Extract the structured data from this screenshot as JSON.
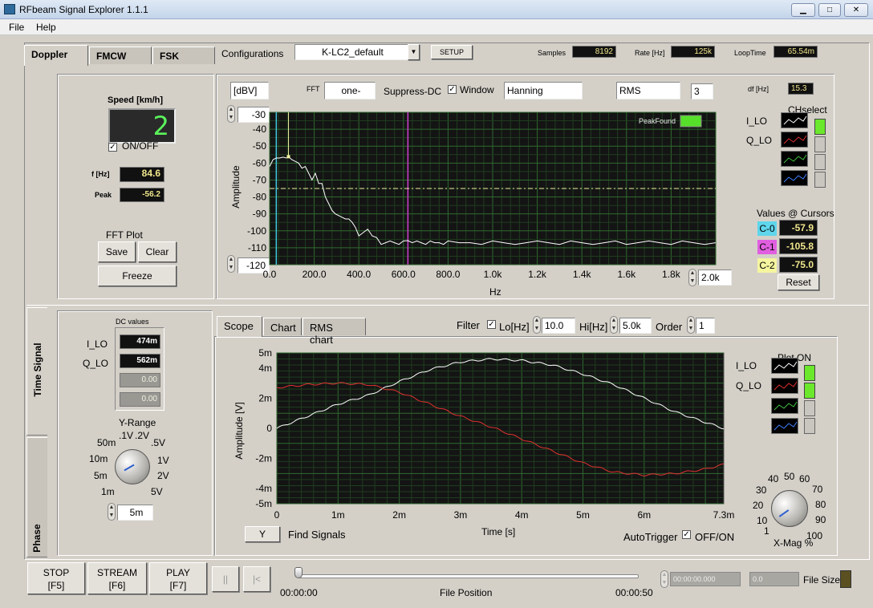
{
  "window": {
    "title": "RFbeam Signal Explorer 1.1.1"
  },
  "menu": [
    "File",
    "Help"
  ],
  "tabs_top": [
    "Doppler",
    "FMCW",
    "FSK"
  ],
  "config": {
    "label": "Configurations",
    "value": "K-LC2_default",
    "setup_label": "SETUP"
  },
  "status": {
    "samples_label": "Samples",
    "samples": "8192",
    "rate_label": "Rate [Hz]",
    "rate": "125k",
    "loop_label": "LoopTime",
    "loop": "65.54m"
  },
  "speed": {
    "label": "Speed [km/h]",
    "value": "2",
    "onoff": "ON/OFF"
  },
  "freq": {
    "f_label": "f [Hz]",
    "f_value": "84.6",
    "peak_label": "Peak",
    "peak_value": "-56.2"
  },
  "fft_plot": {
    "label": "FFT Plot",
    "save": "Save",
    "clear": "Clear",
    "freeze": "Freeze"
  },
  "fft_controls": {
    "unit": "[dBV]",
    "fft_label": "FFT",
    "fft_mode": "one-",
    "suppress_dc": "Suppress-DC",
    "window_label": "Window",
    "window_value": "Hanning",
    "rms": "RMS",
    "rms_count": "3",
    "df_label": "df [Hz]",
    "df_value": "15.3"
  },
  "fft_chart": {
    "ymax_field": "-30",
    "ymin_field": "-120",
    "xmax_field": "2.0k",
    "peakfound": "PeakFound",
    "ylabel": "Amplitude",
    "xlabel": "Hz",
    "yticks": [
      "-30",
      "-40",
      "-50",
      "-60",
      "-70",
      "-80",
      "-90",
      "-100",
      "-110",
      "-120"
    ],
    "xticks": [
      "0.0",
      "200.0",
      "400.0",
      "600.0",
      "800.0",
      "1.0k",
      "1.2k",
      "1.4k",
      "1.6k",
      "1.8k"
    ]
  },
  "chselect": {
    "label": "CHselect",
    "i_lo": "I_LO",
    "q_lo": "Q_LO"
  },
  "cursors": {
    "label": "Values @ Cursors",
    "c0": "C-0",
    "c0v": "-57.9",
    "c1": "C-1",
    "c1v": "-105.8",
    "c2": "C-2",
    "c2v": "-75.0",
    "reset": "Reset"
  },
  "side_tabs": [
    "Time Signal",
    "Phase"
  ],
  "dc": {
    "label": "DC values",
    "i_lo": "I_LO",
    "i_val": "474m",
    "q_lo": "Q_LO",
    "q_val": "562m",
    "v3": "0.00",
    "v4": "0.00"
  },
  "yrange": {
    "label": "Y-Range",
    "labels": [
      "1m",
      "5m",
      "10m",
      "50m",
      ".1V",
      ".2V",
      ".5V",
      "1V",
      "2V",
      "5V"
    ],
    "field": "5m"
  },
  "scope_tabs": [
    "Scope",
    "Chart",
    "RMS chart"
  ],
  "filter": {
    "label": "Filter",
    "lo_label": "Lo[Hz]",
    "lo_value": "10.0",
    "hi_label": "Hi[Hz]",
    "hi_value": "5.0k",
    "order_label": "Order",
    "order_value": "1"
  },
  "scope_chart": {
    "ylabel": "Amplitude [V]",
    "xlabel": "Time [s]",
    "yticks": [
      "5m",
      "4m",
      "2m",
      "0",
      "-2m",
      "-4m",
      "-5m"
    ],
    "xticks": [
      "0",
      "1m",
      "2m",
      "3m",
      "4m",
      "5m",
      "6m",
      "7.3m"
    ]
  },
  "plot_on": {
    "label": "Plot ON",
    "i_lo": "I_LO",
    "q_lo": "Q_LO"
  },
  "scope_buttons": {
    "y": "Y",
    "find": "Find Signals",
    "autotrigger": "AutoTrigger",
    "onoff": "OFF/ON"
  },
  "xmag": {
    "label": "X-Mag %",
    "labels": [
      "1",
      "10",
      "20",
      "30",
      "40",
      "50",
      "60",
      "70",
      "80",
      "90",
      "100"
    ]
  },
  "bottom": {
    "stop": "STOP",
    "stop_key": "[F5]",
    "stream": "STREAM",
    "stream_key": "[F6]",
    "play": "PLAY",
    "play_key": "[F7]",
    "pause": "||",
    "rewind": "|<",
    "t_start": "00:00:00",
    "file_pos": "File Position",
    "t_end": "00:00:50",
    "time_field": "00:00:00.000",
    "num_field": "0.0",
    "file_size": "File Size"
  },
  "chart_data": [
    {
      "type": "line",
      "title": "",
      "xlabel": "Hz",
      "ylabel": "Amplitude",
      "xlim": [
        0,
        2000
      ],
      "ylim": [
        -120,
        -30
      ],
      "series": [
        {
          "name": "",
          "color": "#ffffff",
          "x": [
            0,
            15,
            30,
            45,
            60,
            75,
            84.6,
            100,
            115,
            130,
            145,
            160,
            175,
            190,
            205,
            220,
            235,
            250,
            265,
            280,
            295,
            310,
            325,
            340,
            355,
            370,
            385,
            400,
            420,
            440,
            460,
            480,
            500,
            520,
            540,
            560,
            580,
            600,
            620,
            640,
            660,
            680,
            700,
            720,
            740,
            760,
            780,
            800,
            850,
            900,
            950,
            1000,
            1050,
            1100,
            1150,
            1200,
            1250,
            1300,
            1350,
            1400,
            1450,
            1500,
            1550,
            1600,
            1650,
            1700,
            1750,
            1800,
            1850,
            1900,
            1950,
            2000
          ],
          "y": [
            -62,
            -58,
            -57,
            -57,
            -56.5,
            -57,
            -56.2,
            -58,
            -59,
            -60,
            -63,
            -62,
            -66,
            -70,
            -66,
            -72,
            -72,
            -80,
            -84,
            -88,
            -90,
            -91,
            -92,
            -93,
            -93,
            -95,
            -98,
            -103,
            -101,
            -99,
            -103,
            -104,
            -108,
            -107,
            -106,
            -107,
            -108,
            -106,
            -105.8,
            -107,
            -106,
            -107,
            -108,
            -106,
            -107,
            -107,
            -108,
            -106,
            -107,
            -107,
            -108,
            -106,
            -107,
            -108,
            -107,
            -106,
            -107,
            -108,
            -106,
            -107,
            -108,
            -107,
            -106,
            -108,
            -107,
            -106,
            -107,
            -108,
            -106,
            -107,
            -108,
            -107
          ]
        }
      ],
      "cursors": [
        {
          "name": "C-0",
          "x": 30,
          "color": "#3ec8e0"
        },
        {
          "name": "C-1",
          "x": 620,
          "color": "#d040d0"
        },
        {
          "name": "C-2",
          "y": -75,
          "color": "#f0f0a0"
        }
      ]
    },
    {
      "type": "line",
      "title": "",
      "xlabel": "Time [s]",
      "ylabel": "Amplitude [V]",
      "xlim": [
        0,
        0.0073
      ],
      "ylim": [
        -0.005,
        0.005
      ],
      "series": [
        {
          "name": "I_LO",
          "color": "#ffffff",
          "x": [
            0,
            0.0005,
            0.001,
            0.0015,
            0.002,
            0.0025,
            0.003,
            0.0035,
            0.004,
            0.0045,
            0.005,
            0.0055,
            0.006,
            0.0065,
            0.007,
            0.0073
          ],
          "y": [
            0.0,
            0.0008,
            0.0016,
            0.0022,
            0.0031,
            0.0039,
            0.0044,
            0.0046,
            0.0045,
            0.0042,
            0.0036,
            0.0029,
            0.002,
            0.0011,
            0.0004,
            0.0
          ]
        },
        {
          "name": "Q_LO",
          "color": "#e03030",
          "x": [
            0,
            0.0005,
            0.001,
            0.0015,
            0.002,
            0.0025,
            0.003,
            0.0035,
            0.004,
            0.0045,
            0.005,
            0.0055,
            0.006,
            0.0065,
            0.007,
            0.0073
          ],
          "y": [
            0.0027,
            0.0029,
            0.003,
            0.0029,
            0.0024,
            0.0016,
            0.0008,
            0.0001,
            -0.0007,
            -0.0015,
            -0.0023,
            -0.0029,
            -0.0031,
            -0.003,
            -0.0027,
            -0.0024
          ]
        }
      ]
    }
  ]
}
